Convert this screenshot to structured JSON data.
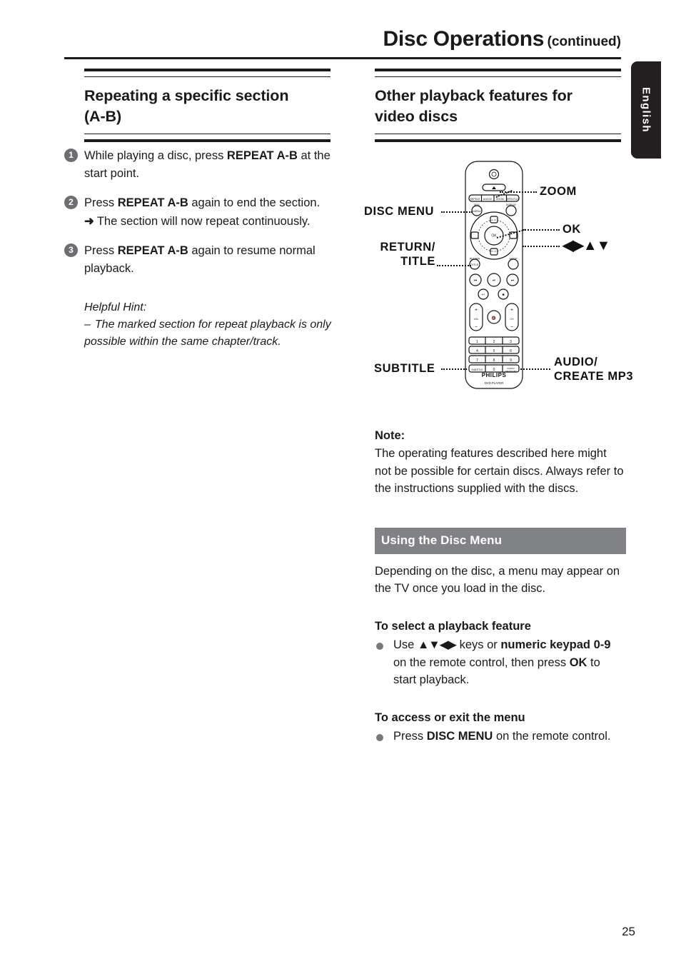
{
  "header": {
    "title": "Disc Operations",
    "continued": "(continued)"
  },
  "language_tab": {
    "label": "English"
  },
  "left_column": {
    "heading_line1": "Repeating a specific section",
    "heading_line2": "(A-B)",
    "steps": [
      {
        "number": "1",
        "text_before": "While playing a disc, press ",
        "bold": "REPEAT A-B",
        "text_after": " at the start point."
      },
      {
        "number": "2",
        "text_before": "Press ",
        "bold": "REPEAT A-B",
        "text_after": " again to end the section.",
        "arrow_glyph": "➜",
        "arrow_text": "The section will now repeat continuously."
      },
      {
        "number": "3",
        "text_before": "Press ",
        "bold": "REPEAT A-B",
        "text_after": " again to resume normal playback."
      }
    ],
    "hint": {
      "title": "Helpful Hint:",
      "dash": "–",
      "text": "The marked section for repeat playback is only possible within the same chapter/track."
    }
  },
  "right_column": {
    "heading_line1": "Other playback features for",
    "heading_line2": "video discs",
    "remote_callouts": {
      "zoom": "ZOOM",
      "ok": "OK",
      "navigation": "◀▶▲▼",
      "disc_menu": "DISC MENU",
      "return_title_line1": "RETURN/",
      "return_title_line2": "TITLE",
      "subtitle": "SUBTITLE",
      "audio_line1": "AUDIO/",
      "audio_line2": "CREATE MP3"
    },
    "remote_brand": "PHILIPS",
    "remote_model": "DVD PLAYER",
    "remote_top_row_keys": [
      "REPEAT",
      "ANGLE",
      "ZOOM",
      "REPEAT A-B"
    ],
    "remote_keypad": [
      "1",
      "2",
      "3",
      "4",
      "5",
      "6",
      "7",
      "8",
      "9",
      "SUBTITLE",
      "0",
      "AUDIO/ CREATE MP3"
    ],
    "note": {
      "title": "Note:",
      "text": "The operating features described here might not be possible for certain discs. Always refer to the instructions supplied with the discs."
    },
    "disc_menu_bar": "Using the Disc Menu",
    "disc_menu_intro": "Depending on the disc, a menu may appear on the TV once you load in the disc.",
    "select_feature": {
      "heading": "To select a playback feature",
      "part1": "Use ",
      "arrows": "▲▼◀▶",
      "part2": " keys or ",
      "bold1": "numeric keypad 0-9",
      "part3": " on the remote control, then press ",
      "bold2": "OK",
      "part4": " to start playback."
    },
    "access_menu": {
      "heading": "To access or exit the menu",
      "part1": "Press ",
      "bold1": "DISC MENU",
      "part2": " on the remote control."
    }
  },
  "footer": {
    "page_number": "25"
  }
}
